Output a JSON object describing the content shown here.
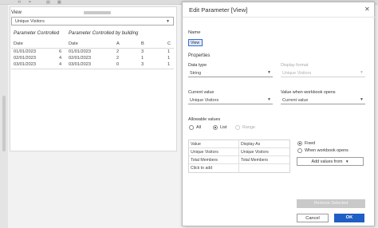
{
  "view_filter": {
    "label": "View",
    "selected": "Unique Visitors"
  },
  "worksheet": {
    "left_title": "Parameter Controlled",
    "right_title": "Parameter Controlled by building",
    "left_header": [
      "Date",
      ""
    ],
    "right_header": [
      "Date",
      "A",
      "B",
      "C"
    ],
    "left_rows": [
      [
        "01/01/2023",
        "6"
      ],
      [
        "02/01/2023",
        "4"
      ],
      [
        "03/01/2023",
        "4"
      ]
    ],
    "right_rows": [
      [
        "01/01/2023",
        "2",
        "3",
        "1"
      ],
      [
        "02/01/2023",
        "2",
        "1",
        "1"
      ],
      [
        "03/01/2023",
        "0",
        "3",
        "1"
      ]
    ]
  },
  "dialog": {
    "title": "Edit Parameter [View]",
    "close_glyph": "✕",
    "name_label": "Name",
    "name_value": "View",
    "properties_label": "Properties",
    "data_type_label": "Data type",
    "data_type_value": "String",
    "display_format_label": "Display format",
    "display_format_value": "Unique Visitors",
    "current_value_label": "Current value",
    "current_value_value": "Unique Visitors",
    "workbook_opens_label": "Value when workbook opens",
    "workbook_opens_value": "Current value",
    "allowable_label": "Allowable values",
    "allowable_options": [
      "All",
      "List",
      "Range"
    ],
    "allowable_selected": "List",
    "table_headers": [
      "Value",
      "Display As"
    ],
    "table_rows": [
      [
        "Unique Visitors",
        "Unique Visitors"
      ],
      [
        "Total Members",
        "Total Members"
      ],
      [
        "Click to add",
        ""
      ]
    ],
    "fixed_label": "Fixed",
    "when_opens_label": "When workbook opens",
    "add_values_label": "Add values from",
    "remove_selected_label": "Remove Selected",
    "cancel_label": "Cancel",
    "ok_label": "OK"
  },
  "colors": {
    "accent": "#1f5ec4",
    "name_highlight": "#dfe9fb"
  }
}
